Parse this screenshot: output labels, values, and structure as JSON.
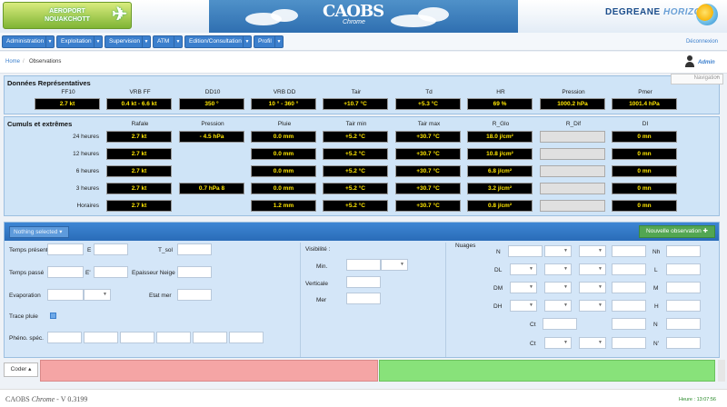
{
  "header": {
    "airport_line1": "AEROPORT",
    "airport_line2": "NOUAKCHOTT",
    "app_name": "CAOBS",
    "app_sub": "Chrome",
    "brand_main": "DEGREANE",
    "brand_sub": "HORIZON"
  },
  "menu": {
    "items": [
      "Administration",
      "Exploitation",
      "Supervision",
      "ATM",
      "Edition/Consultation",
      "Profil"
    ],
    "logout": "Déconnexion"
  },
  "breadcrumb": {
    "home": "Home",
    "current": "Observations"
  },
  "user": {
    "name": "Admin"
  },
  "nav_tip": "Navigation",
  "repr": {
    "title": "Données Représentatives",
    "headers": [
      "FF10",
      "VRB FF",
      "DD10",
      "VRB DD",
      "Tair",
      "Td",
      "HR",
      "Pression",
      "Pmer"
    ],
    "values": [
      "2.7 kt",
      "0.4 kt  -  6.6 kt",
      "350 °",
      "10 °  -  360 °",
      "+10.7 °C",
      "+5.3 °C",
      "69 %",
      "1000.2 hPa",
      "1001.4 hPa"
    ]
  },
  "cumuls": {
    "title": "Cumuls et extrêmes",
    "headers": [
      "Rafale",
      "Pression",
      "Pluie",
      "Tair min",
      "Tair max",
      "R_Glo",
      "R_Dif",
      "DI"
    ],
    "rows": [
      {
        "label": "24 heures",
        "values": [
          "2.7 kt",
          "- 4.5 hPa",
          "0.0  mm",
          "+5.2  °C",
          "+30.7  °C",
          "18.0 j/cm²",
          "",
          "0 mn"
        ]
      },
      {
        "label": "12 heures",
        "values": [
          "2.7 kt",
          "",
          "0.0  mm",
          "+5.2  °C",
          "+30.7  °C",
          "10.8 j/cm²",
          "",
          "0 mn"
        ]
      },
      {
        "label": "6 heures",
        "values": [
          "2.7 kt",
          "",
          "0.0  mm",
          "+5.2  °C",
          "+30.7  °C",
          "6.8 j/cm²",
          "",
          "0 mn"
        ]
      },
      {
        "label": "3 heures",
        "values": [
          "2.7 kt",
          "0.7 hPa 8",
          "0.0  mm",
          "+5.2  °C",
          "+30.7  °C",
          "3.2 j/cm²",
          "",
          "0 mn"
        ]
      },
      {
        "label": "Horaires",
        "values": [
          "2.7 kt",
          "",
          "1.2  mm",
          "+5.2  °C",
          "+30.7  °C",
          "0.8 j/cm²",
          "",
          "0 mn"
        ]
      }
    ]
  },
  "form": {
    "selector": "Nothing selected",
    "new_obs": "Nouvelle observation",
    "left": {
      "temps_present": "Temps présent",
      "e": "E",
      "t_sol": "T_sol",
      "temps_passe": "Temps passé",
      "e_prime": "E'",
      "epaisseur": "Epaisseur Neige",
      "evaporation": "Evaporation",
      "etat_mer": "Etat mer",
      "trace_pluie": "Trace pluie",
      "pheno": "Phéno. spéc."
    },
    "visibility": {
      "title": "Visibilité :",
      "min": "Min.",
      "verticale": "Verticale",
      "mer": "Mer"
    },
    "clouds": {
      "title": "Nuages",
      "left_labels": [
        "N",
        "DL",
        "DM",
        "DH"
      ],
      "right_labels": [
        "Nh",
        "L",
        "M",
        "H",
        "N",
        "N'"
      ],
      "ct": "Ct"
    }
  },
  "coder": {
    "label": "Coder"
  },
  "footer": {
    "app": "CAOBS",
    "app_italic": "Chrome",
    "version": "- V 0.3199",
    "time": "Heure : 13:07:56"
  }
}
